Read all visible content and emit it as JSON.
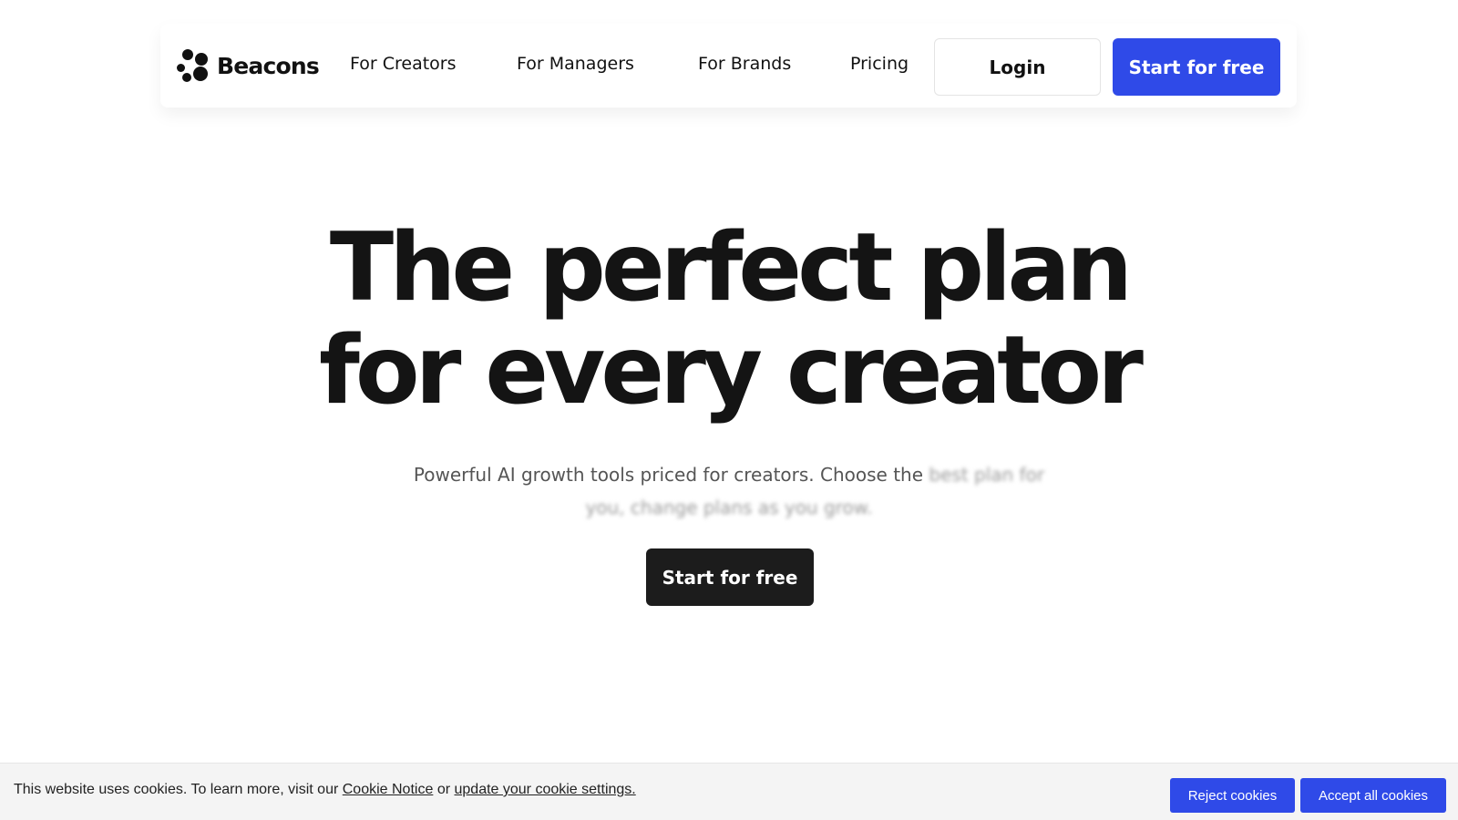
{
  "nav": {
    "brand_name": "Beacons",
    "links": [
      "For Creators",
      "For Managers",
      "For Brands",
      "Pricing"
    ],
    "login_label": "Login",
    "start_label": "Start for free"
  },
  "hero": {
    "title_line1": "The perfect plan",
    "title_line2": "for every creator",
    "subtitle_visible": "Powerful AI growth tools priced for creators. Choose the",
    "subtitle_faded": "best plan for you, change plans as you grow.",
    "cta_label": "Start for free"
  },
  "cookie": {
    "text_before": "This website uses cookies. To learn more, visit our",
    "notice_link": "Cookie Notice",
    "text_or": "or",
    "settings_link": "update your cookie settings.",
    "reject_label": "Reject cookies",
    "accept_label": "Accept all cookies"
  },
  "colors": {
    "accent": "#2f4ae8",
    "dark_button": "#1c1c1c",
    "heading": "#141414",
    "banner_bg": "#f4f4f4"
  },
  "icons": {
    "logo": "beacons-logo-icon"
  }
}
